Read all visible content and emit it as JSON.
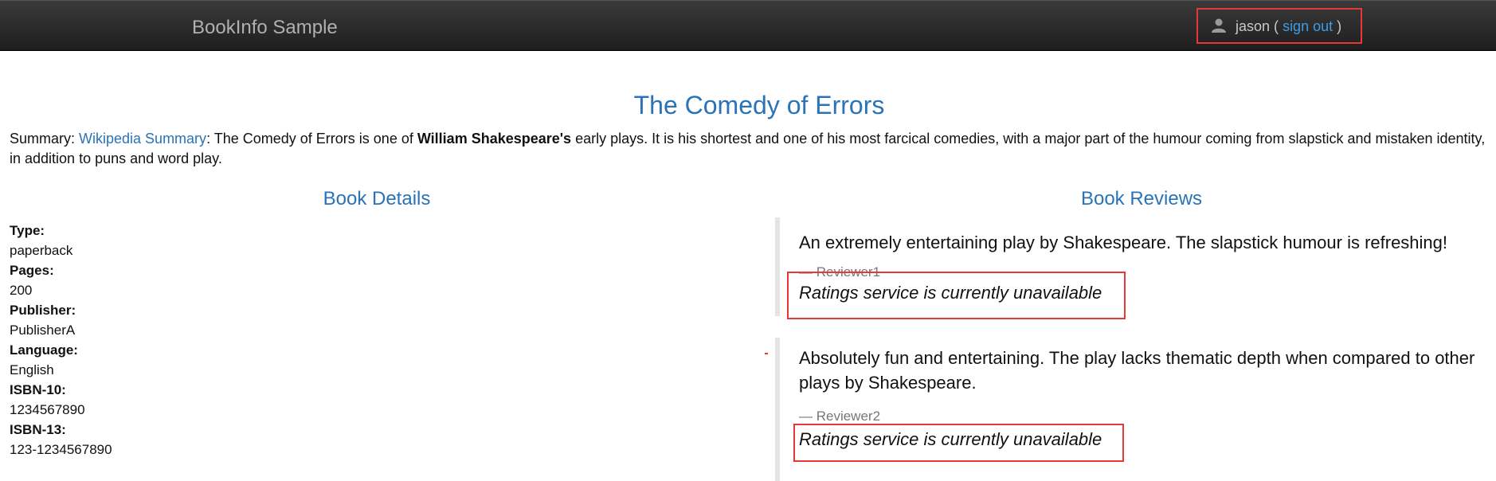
{
  "navbar": {
    "brand": "BookInfo Sample",
    "user_icon": "user-icon",
    "username": "jason",
    "sign_out": "sign out",
    "open_paren": "(",
    "close_paren": ")"
  },
  "book": {
    "title": "The Comedy of Errors",
    "summary_prefix": "Summary: ",
    "summary_link": "Wikipedia Summary",
    "summary_text_1": ": The Comedy of Errors is one of ",
    "summary_author": "William Shakespeare's",
    "summary_text_2": " early plays. It is his shortest and one of his most farcical comedies, with a major part of the humour coming from slapstick and mistaken identity, in addition to puns and word play."
  },
  "details": {
    "heading": "Book Details",
    "items": [
      {
        "label": "Type:",
        "value": "paperback"
      },
      {
        "label": "Pages:",
        "value": "200"
      },
      {
        "label": "Publisher:",
        "value": "PublisherA"
      },
      {
        "label": "Language:",
        "value": "English"
      },
      {
        "label": "ISBN-10:",
        "value": "1234567890"
      },
      {
        "label": "ISBN-13:",
        "value": "123-1234567890"
      }
    ]
  },
  "reviews": {
    "heading": "Book Reviews",
    "items": [
      {
        "text": "An extremely entertaining play by Shakespeare. The slapstick humour is refreshing!",
        "reviewer": "— Reviewer1",
        "rating": "Ratings service is currently unavailable"
      },
      {
        "text": "Absolutely fun and entertaining. The play lacks thematic depth when compared to other plays by Shakespeare.",
        "reviewer": "— Reviewer2",
        "rating": "Ratings service is currently unavailable"
      }
    ]
  },
  "colors": {
    "accent": "#2a73b8",
    "link": "#3b9ce9",
    "highlight": "#e53935",
    "navbar": "#2b2b2b"
  }
}
